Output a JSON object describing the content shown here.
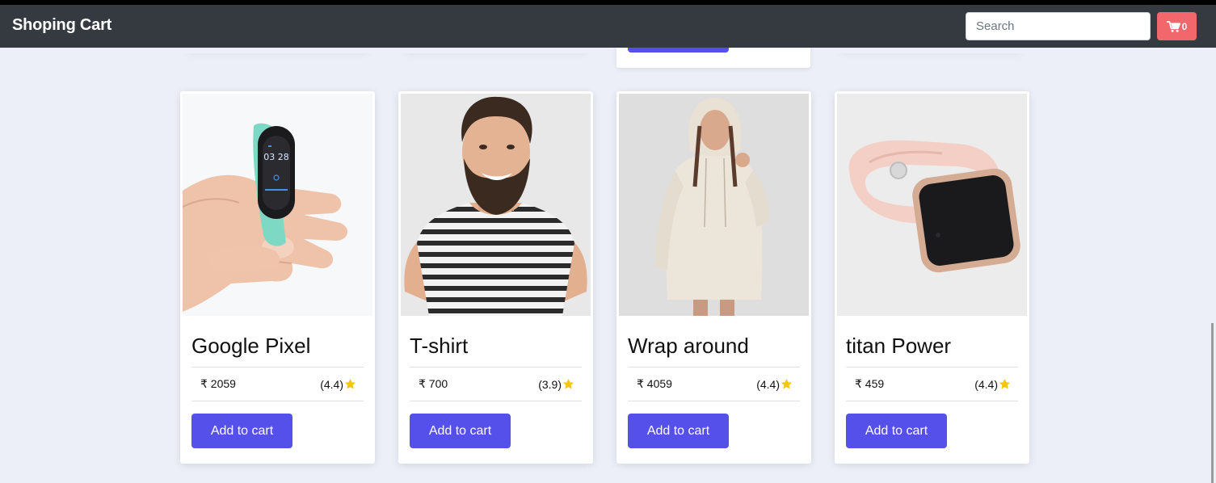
{
  "navbar": {
    "brand": "Shoping Cart",
    "search_placeholder": "Search",
    "cart_count": "0"
  },
  "products": [
    {
      "title": "Google Pixel",
      "price": "₹ 2059",
      "rating": "(4.4)",
      "button": "Add to cart",
      "image": "fitness-band-photo"
    },
    {
      "title": "T-shirt",
      "price": "₹ 700",
      "rating": "(3.9)",
      "button": "Add to cart",
      "image": "striped-tshirt-man-photo"
    },
    {
      "title": "Wrap around",
      "price": "₹ 4059",
      "rating": "(4.4)",
      "button": "Add to cart",
      "image": "hoodie-dress-woman-photo"
    },
    {
      "title": "titan Power",
      "price": "₹ 459",
      "rating": "(4.4)",
      "button": "Add to cart",
      "image": "pink-smartwatch-photo"
    }
  ],
  "colors": {
    "navbar": "#343a40",
    "accent": "#5650ea",
    "cart": "#f2676b",
    "star": "#f5c518",
    "background": "#eceef8"
  }
}
